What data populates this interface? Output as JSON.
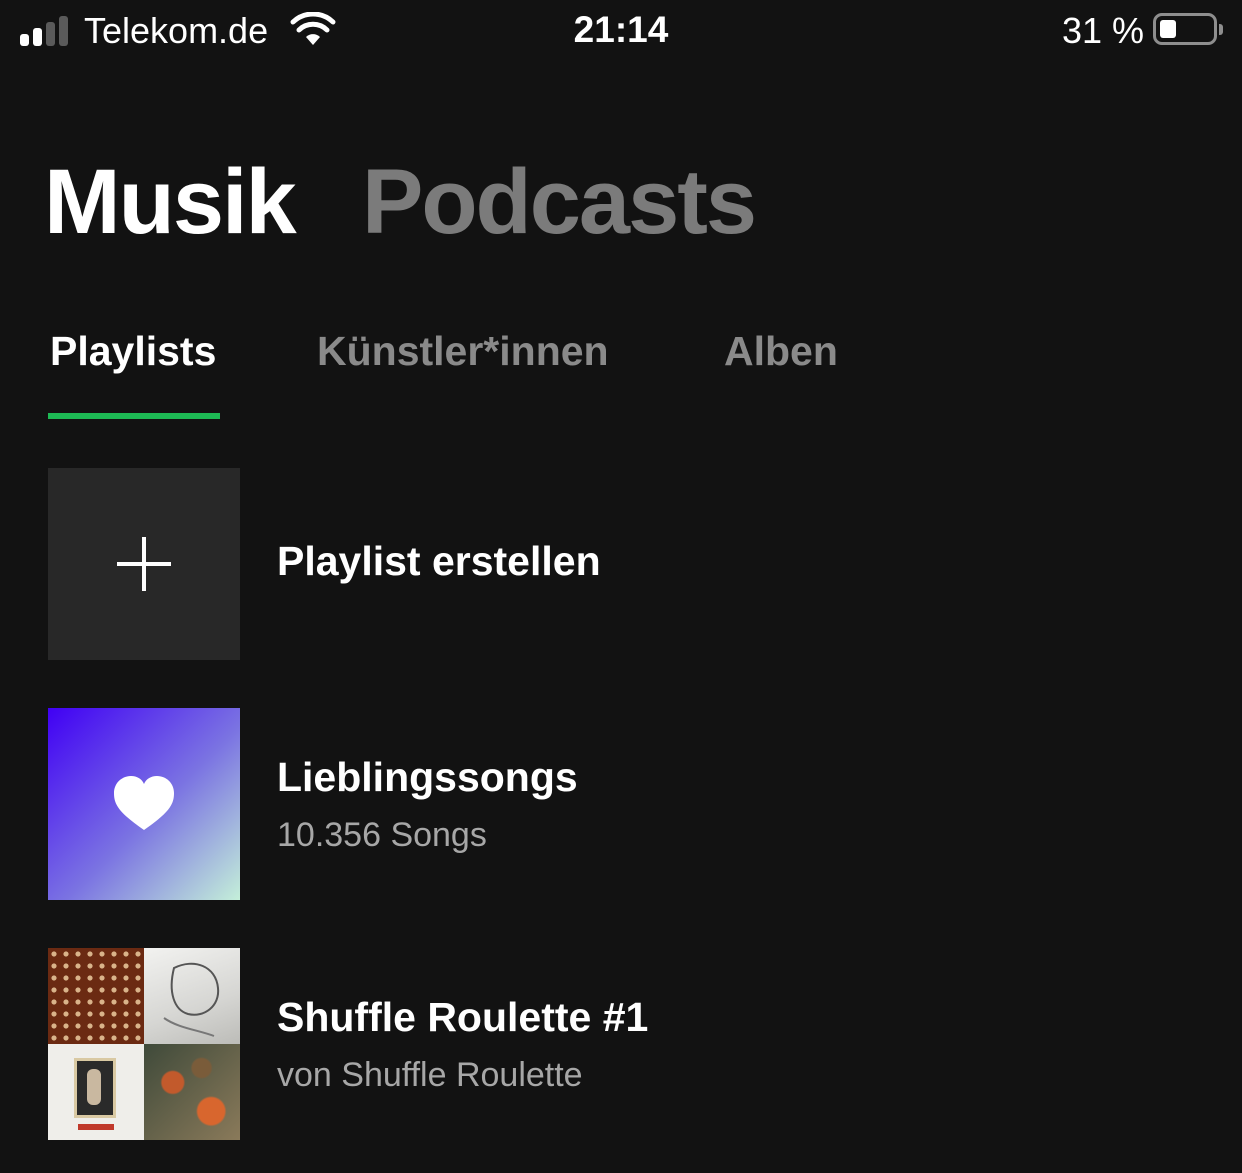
{
  "status_bar": {
    "carrier": "Telekom.de",
    "time": "21:14",
    "battery_percent": "31 %",
    "battery_level": 0.31,
    "signal_bars_active": 2,
    "signal_bars_total": 4
  },
  "main_tabs": {
    "active": "Musik",
    "items": [
      {
        "label": "Musik"
      },
      {
        "label": "Podcasts"
      }
    ]
  },
  "sub_tabs": {
    "active": "Playlists",
    "items": [
      {
        "label": "Playlists"
      },
      {
        "label": "Künstler*innen"
      },
      {
        "label": "Alben"
      }
    ]
  },
  "list": {
    "create": {
      "label": "Playlist erstellen",
      "icon": "plus-icon"
    },
    "items": [
      {
        "title": "Lieblingssongs",
        "subtitle": "10.356 Songs",
        "icon": "heart-icon"
      },
      {
        "title": "Shuffle Roulette #1",
        "subtitle": "von Shuffle Roulette"
      }
    ]
  },
  "colors": {
    "background": "#121212",
    "accent": "#1db954",
    "inactive_text": "#7b7b7b",
    "secondary_text": "#a7a7a7"
  }
}
